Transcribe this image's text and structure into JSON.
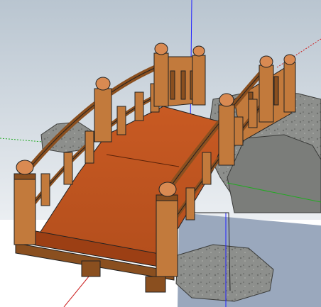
{
  "viewport": {
    "sky_top": "#b9c5d0",
    "sky_bottom": "#eef1f4",
    "ground": "#ffffff",
    "water": "#9aa8bd",
    "rock": "#8d8f8c",
    "rock_dark": "#5e605d",
    "deck": "#c85a23",
    "deck_dark": "#9c3f14",
    "timber": "#c27a3c",
    "timber_dark": "#8a4f1f",
    "cap": "#d98a52",
    "axis_blue": "#2222ff",
    "axis_green": "#22aa22",
    "axis_red": "#cc2222"
  },
  "model": {
    "objects": [
      "arched-wooden-bridge",
      "stone-abutment-right",
      "stone-abutment-left",
      "water-plane"
    ]
  }
}
